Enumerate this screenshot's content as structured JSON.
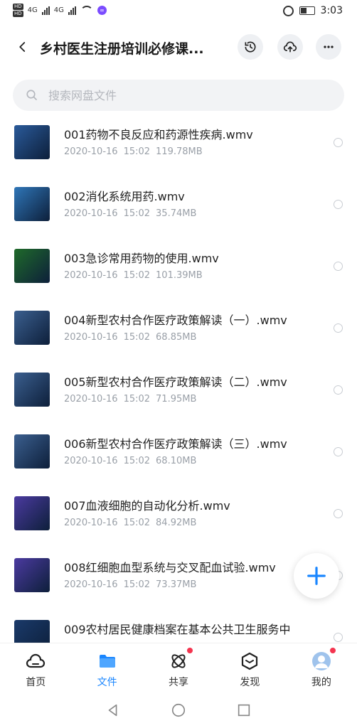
{
  "status_bar": {
    "time": "3:03",
    "hd_label": "HD",
    "net_label": "4G"
  },
  "header": {
    "title": "乡村医生注册培训必修课...",
    "icons": [
      "back-arrow-icon",
      "history-icon",
      "cloud-upload-icon",
      "more-icon"
    ]
  },
  "search": {
    "placeholder": "搜索网盘文件"
  },
  "files": [
    {
      "name": "001药物不良反应和药源性疾病.wmv",
      "date": "2020-10-16",
      "time": "15:02",
      "size": "119.78MB",
      "thumb": "#2a5a9a"
    },
    {
      "name": "002消化系统用药.wmv",
      "date": "2020-10-16",
      "time": "15:02",
      "size": "35.74MB",
      "thumb": "#2f76b8"
    },
    {
      "name": "003急诊常用药物的使用.wmv",
      "date": "2020-10-16",
      "time": "15:02",
      "size": "101.39MB",
      "thumb": "#1f6a2a"
    },
    {
      "name": "004新型农村合作医疗政策解读（一）.wmv",
      "date": "2020-10-16",
      "time": "15:02",
      "size": "68.85MB",
      "thumb": "#3b5f8f"
    },
    {
      "name": "005新型农村合作医疗政策解读（二）.wmv",
      "date": "2020-10-16",
      "time": "15:02",
      "size": "71.95MB",
      "thumb": "#3b5f8f"
    },
    {
      "name": "006新型农村合作医疗政策解读（三）.wmv",
      "date": "2020-10-16",
      "time": "15:02",
      "size": "68.10MB",
      "thumb": "#3b5f8f"
    },
    {
      "name": "007血液细胞的自动化分析.wmv",
      "date": "2020-10-16",
      "time": "15:02",
      "size": "84.92MB",
      "thumb": "#4b3aa0"
    },
    {
      "name": "008红细胞血型系统与交叉配血试验.wmv",
      "date": "2020-10-16",
      "time": "15:02",
      "size": "73.37MB",
      "thumb": "#4b3aa0"
    },
    {
      "name": "009农村居民健康档案在基本公共卫生服务中",
      "date": "",
      "time": "",
      "size": "",
      "thumb": "#1a3a6a"
    }
  ],
  "bottom_nav": [
    {
      "label": "首页",
      "icon": "home-cloud-icon",
      "active": false,
      "badge": false
    },
    {
      "label": "文件",
      "icon": "folder-icon",
      "active": true,
      "badge": false
    },
    {
      "label": "共享",
      "icon": "share-atom-icon",
      "active": false,
      "badge": true
    },
    {
      "label": "发现",
      "icon": "discover-box-icon",
      "active": false,
      "badge": false
    },
    {
      "label": "我的",
      "icon": "avatar-icon",
      "active": false,
      "badge": true
    }
  ],
  "colors": {
    "accent": "#1a86ff",
    "badge": "#f4344f"
  }
}
